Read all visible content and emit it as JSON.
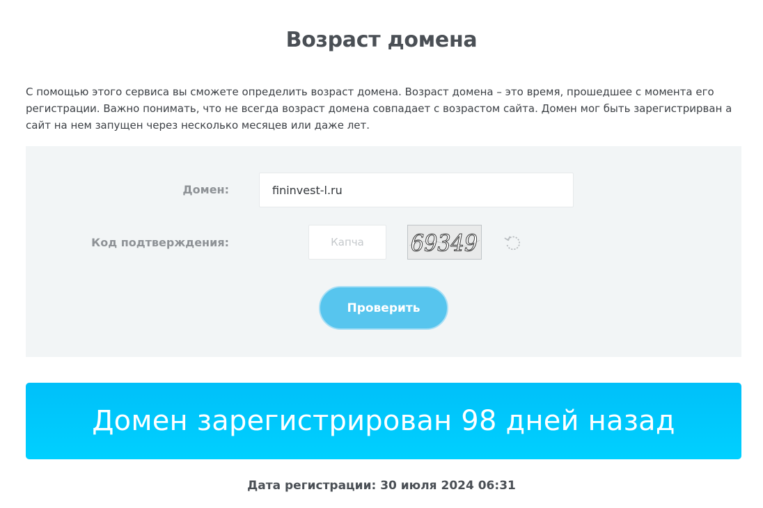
{
  "page": {
    "title": "Возраст домена",
    "intro": "С помощью этого сервиса вы сможете определить возраст домена. Возраст домена – это время, прошедшее с момента его регистрации. Важно понимать, что не всегда возраст домена совпадает с возрастом сайта. Домен мог быть зарегистрирван а сайт на нем запущен через несколько месяцев или даже лет."
  },
  "form": {
    "domain_label": "Домен:",
    "domain_value": "fininvest-l.ru",
    "code_label": "Код подтверждения:",
    "captcha_placeholder": "Капча",
    "captcha_text": "69349",
    "submit_label": "Проверить",
    "refresh_icon": "refresh-icon"
  },
  "result": {
    "banner_text": "Домен зарегистрирован 98 дней назад",
    "reg_date_text": "Дата регистрации: 30 июля 2024 06:31"
  },
  "colors": {
    "banner": "#00c8fc",
    "button": "#57c5ee",
    "panel": "#f2f5f6"
  }
}
